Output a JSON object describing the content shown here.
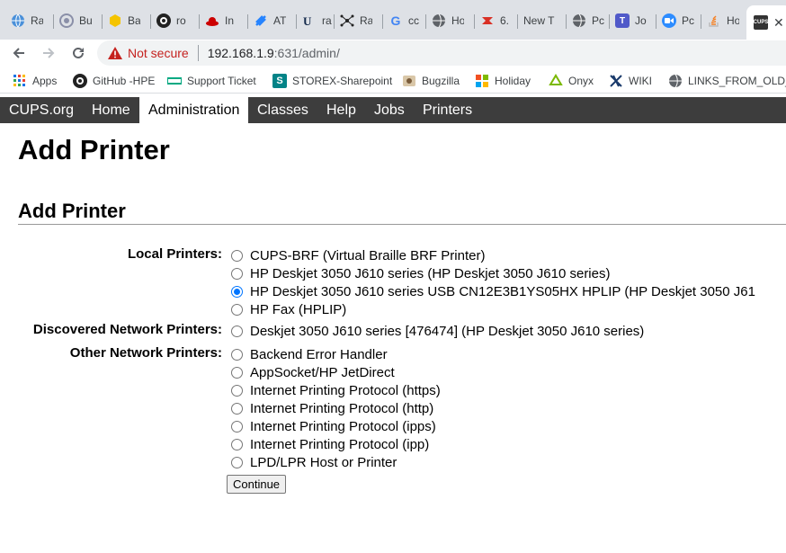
{
  "tabs": [
    {
      "title": "Ra",
      "icon": "globe-icon",
      "color": "#1a73e8"
    },
    {
      "title": "Bu",
      "icon": "bugzilla-icon",
      "color": "#8a8fa8"
    },
    {
      "title": "Ba",
      "icon": "hexagon-icon",
      "color": "#f5c400"
    },
    {
      "title": "ro",
      "icon": "github-icon",
      "color": "#222222"
    },
    {
      "title": "In",
      "icon": "redhat-icon",
      "color": "#cc0000"
    },
    {
      "title": "AT",
      "icon": "jira-icon",
      "color": "#2684ff"
    },
    {
      "title": "ra",
      "icon": "uiuc-icon",
      "color": "#13294b"
    },
    {
      "title": "Ra",
      "icon": "network-icon",
      "color": "#222222"
    },
    {
      "title": "cc",
      "icon": "google-icon",
      "color": "#4285f4"
    },
    {
      "title": "Ho",
      "icon": "globe-gray-icon",
      "color": "#5f6368"
    },
    {
      "title": "6.",
      "icon": "fedora-icon",
      "color": "#d93025"
    },
    {
      "title": "New T",
      "icon": "",
      "color": ""
    },
    {
      "title": "Pc",
      "icon": "globe-gray-icon",
      "color": "#5f6368"
    },
    {
      "title": "Jo",
      "icon": "teams-icon",
      "color": "#5059c9"
    },
    {
      "title": "Pc",
      "icon": "zoom-icon",
      "color": "#2d8cff"
    },
    {
      "title": "Ho",
      "icon": "stackoverflow-icon",
      "color": "#f48024"
    },
    {
      "title": "CUPS",
      "icon": "cups-icon",
      "color": "#333333"
    }
  ],
  "address": {
    "warning": "Not secure",
    "host": "192.168.1.9",
    "path": ":631/admin/"
  },
  "bookmarks": [
    {
      "label": "Apps",
      "icon": "apps-grid-icon"
    },
    {
      "label": "GitHub -HPE",
      "icon": "github-icon"
    },
    {
      "label": "Support Ticket",
      "icon": "hpe-icon"
    },
    {
      "label": "STOREX-Sharepoint",
      "icon": "sharepoint-icon"
    },
    {
      "label": "Bugzilla",
      "icon": "bugzilla-icon"
    },
    {
      "label": "Holiday",
      "icon": "windows-icon"
    },
    {
      "label": "Onyx",
      "icon": "onyx-icon"
    },
    {
      "label": "WIKI",
      "icon": "wiki-icon"
    },
    {
      "label": "LINKS_FROM_OLD_...",
      "icon": "globe-gray-icon"
    }
  ],
  "cups_nav": [
    {
      "label": "CUPS.org"
    },
    {
      "label": "Home"
    },
    {
      "label": "Administration",
      "selected": true
    },
    {
      "label": "Classes"
    },
    {
      "label": "Help"
    },
    {
      "label": "Jobs"
    },
    {
      "label": "Printers"
    }
  ],
  "page": {
    "title": "Add Printer",
    "section_title": "Add Printer",
    "groups": {
      "local": "Local Printers:",
      "discovered": "Discovered Network Printers:",
      "other": "Other Network Printers:"
    },
    "local_printers": [
      {
        "label": "CUPS-BRF (Virtual Braille BRF Printer)",
        "checked": false
      },
      {
        "label": "HP Deskjet 3050 J610 series (HP Deskjet 3050 J610 series)",
        "checked": false
      },
      {
        "label": "HP Deskjet 3050 J610 series USB CN12E3B1YS05HX HPLIP (HP Deskjet 3050 J61",
        "checked": true
      },
      {
        "label": "HP Fax (HPLIP)",
        "checked": false
      }
    ],
    "discovered_printers": [
      {
        "label": "Deskjet 3050 J610 series [476474] (HP Deskjet 3050 J610 series)",
        "checked": false
      }
    ],
    "other_printers": [
      {
        "label": "Backend Error Handler",
        "checked": false
      },
      {
        "label": "AppSocket/HP JetDirect",
        "checked": false
      },
      {
        "label": "Internet Printing Protocol (https)",
        "checked": false
      },
      {
        "label": "Internet Printing Protocol (http)",
        "checked": false
      },
      {
        "label": "Internet Printing Protocol (ipps)",
        "checked": false
      },
      {
        "label": "Internet Printing Protocol (ipp)",
        "checked": false
      },
      {
        "label": "LPD/LPR Host or Printer",
        "checked": false
      }
    ],
    "continue_label": "Continue"
  }
}
